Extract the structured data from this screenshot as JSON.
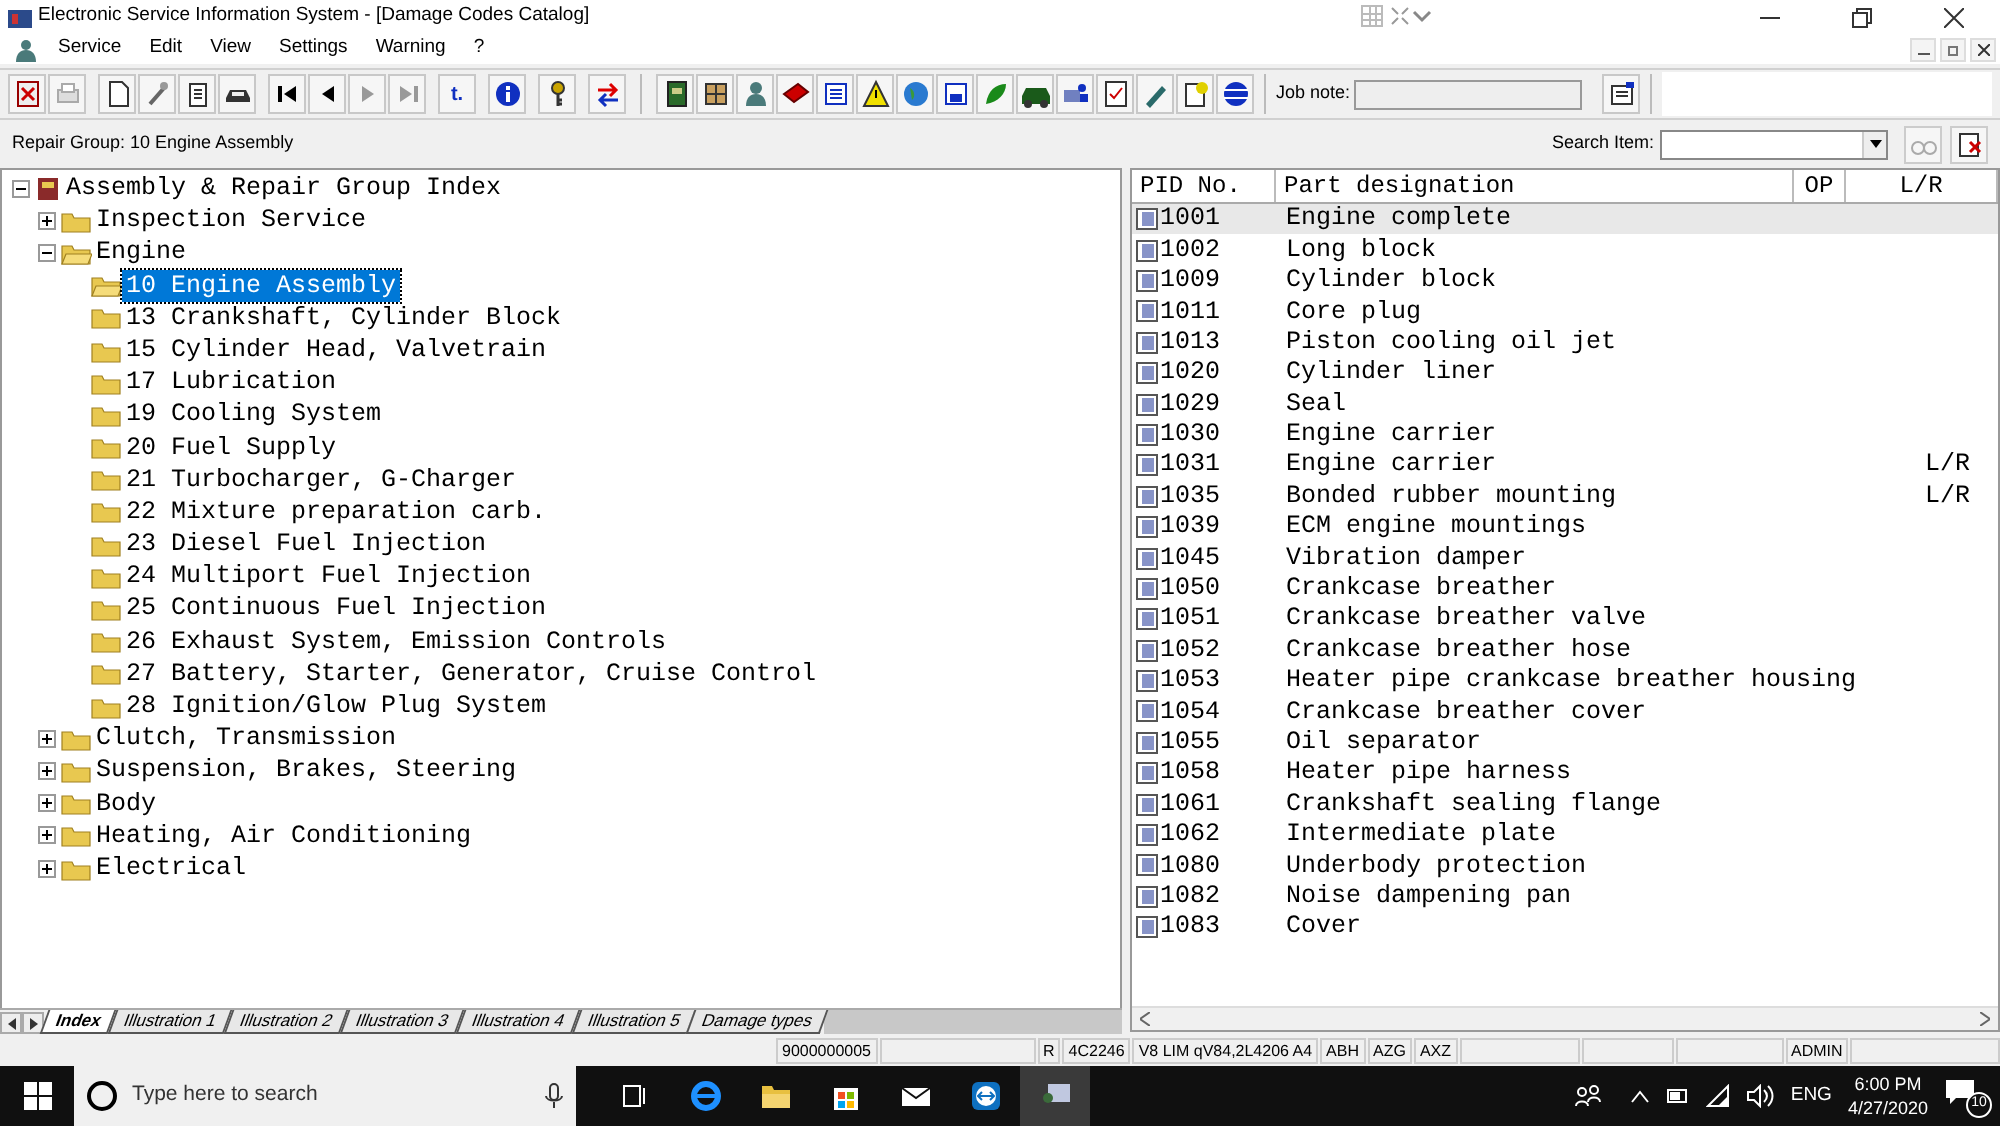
{
  "window": {
    "title": "Electronic Service Information System - [Damage Codes Catalog]"
  },
  "menu": [
    "Service",
    "Edit",
    "View",
    "Settings",
    "Warning",
    "?"
  ],
  "toolbar": {
    "text_button": "t.",
    "job_note_label": "Job note:"
  },
  "repair_group": "Repair Group: 10 Engine Assembly",
  "search": {
    "label": "Search Item:"
  },
  "tree": {
    "label": "Assembly & Repair Group Index",
    "expanded": true,
    "children": [
      {
        "label": "Inspection Service",
        "expanded": false
      },
      {
        "label": "Engine",
        "expanded": true,
        "children": [
          {
            "label": "10 Engine Assembly",
            "selected": true
          },
          {
            "label": "13 Crankshaft, Cylinder Block",
            "selected": false
          },
          {
            "label": "15 Cylinder Head, Valvetrain",
            "selected": false
          },
          {
            "label": "17 Lubrication",
            "selected": false
          },
          {
            "label": "19 Cooling System",
            "selected": false
          },
          {
            "label": "20 Fuel Supply",
            "selected": false
          },
          {
            "label": "21 Turbocharger, G-Charger",
            "selected": false
          },
          {
            "label": "22 Mixture preparation carb.",
            "selected": false
          },
          {
            "label": "23 Diesel Fuel Injection",
            "selected": false
          },
          {
            "label": "24 Multiport Fuel Injection",
            "selected": false
          },
          {
            "label": "25 Continuous Fuel Injection",
            "selected": false
          },
          {
            "label": "26 Exhaust System, Emission Controls",
            "selected": false
          },
          {
            "label": "27 Battery, Starter, Generator, Cruise Control",
            "selected": false
          },
          {
            "label": "28 Ignition/Glow Plug System",
            "selected": false
          }
        ]
      },
      {
        "label": "Clutch, Transmission",
        "expanded": false
      },
      {
        "label": "Suspension, Brakes, Steering",
        "expanded": false
      },
      {
        "label": "Body",
        "expanded": false
      },
      {
        "label": "Heating, Air Conditioning",
        "expanded": false
      },
      {
        "label": "Electrical",
        "expanded": false
      }
    ]
  },
  "parts": {
    "columns": [
      "PID No.",
      "Part designation",
      "OP",
      "L/R"
    ],
    "rows": [
      {
        "pid": "1001",
        "designation": "Engine complete",
        "selected": true
      },
      {
        "pid": "1002",
        "designation": "Long block",
        "selected": false
      },
      {
        "pid": "1009",
        "designation": "Cylinder block",
        "selected": false
      },
      {
        "pid": "1011",
        "designation": "Core plug",
        "selected": false
      },
      {
        "pid": "1013",
        "designation": "Piston cooling oil jet",
        "selected": false
      },
      {
        "pid": "1020",
        "designation": "Cylinder liner",
        "selected": false
      },
      {
        "pid": "1029",
        "designation": "Seal",
        "selected": false
      },
      {
        "pid": "1030",
        "designation": "Engine carrier",
        "selected": false
      },
      {
        "pid": "1031",
        "designation": "Engine carrier",
        "lr": "L/R",
        "selected": false
      },
      {
        "pid": "1035",
        "designation": "Bonded rubber mounting",
        "lr": "L/R",
        "selected": false
      },
      {
        "pid": "1039",
        "designation": "ECM engine mountings",
        "selected": false
      },
      {
        "pid": "1045",
        "designation": "Vibration damper",
        "selected": false
      },
      {
        "pid": "1050",
        "designation": "Crankcase breather",
        "selected": false
      },
      {
        "pid": "1051",
        "designation": "Crankcase breather valve",
        "selected": false
      },
      {
        "pid": "1052",
        "designation": "Crankcase breather hose",
        "selected": false
      },
      {
        "pid": "1053",
        "designation": "Heater pipe crankcase breather housing",
        "selected": false
      },
      {
        "pid": "1054",
        "designation": "Crankcase breather cover",
        "selected": false
      },
      {
        "pid": "1055",
        "designation": "Oil separator",
        "selected": false
      },
      {
        "pid": "1058",
        "designation": "Heater pipe harness",
        "selected": false
      },
      {
        "pid": "1061",
        "designation": "Crankshaft sealing flange",
        "selected": false
      },
      {
        "pid": "1062",
        "designation": "Intermediate plate",
        "selected": false
      },
      {
        "pid": "1080",
        "designation": "Underbody protection",
        "selected": false
      },
      {
        "pid": "1082",
        "designation": "Noise dampening pan",
        "selected": false
      },
      {
        "pid": "1083",
        "designation": "Cover",
        "selected": false
      }
    ]
  },
  "tabs": [
    {
      "label": "Index",
      "selected": true
    },
    {
      "label": "Illustration 1",
      "selected": false
    },
    {
      "label": "Illustration 2",
      "selected": false
    },
    {
      "label": "Illustration 3",
      "selected": false
    },
    {
      "label": "Illustration 4",
      "selected": false
    },
    {
      "label": "Illustration 5",
      "selected": false
    },
    {
      "label": "Damage types",
      "selected": false
    }
  ],
  "status_bar": [
    "9000000005",
    "R",
    "4C2246",
    "V8 LIM qV84,2L4206 A4",
    "ABH",
    "AZG",
    "AXZ",
    "ADMIN"
  ],
  "taskbar": {
    "search_placeholder": "Type here to search",
    "language": "ENG",
    "time": "6:00 PM",
    "date": "4/27/2020",
    "notification_count": "10"
  }
}
